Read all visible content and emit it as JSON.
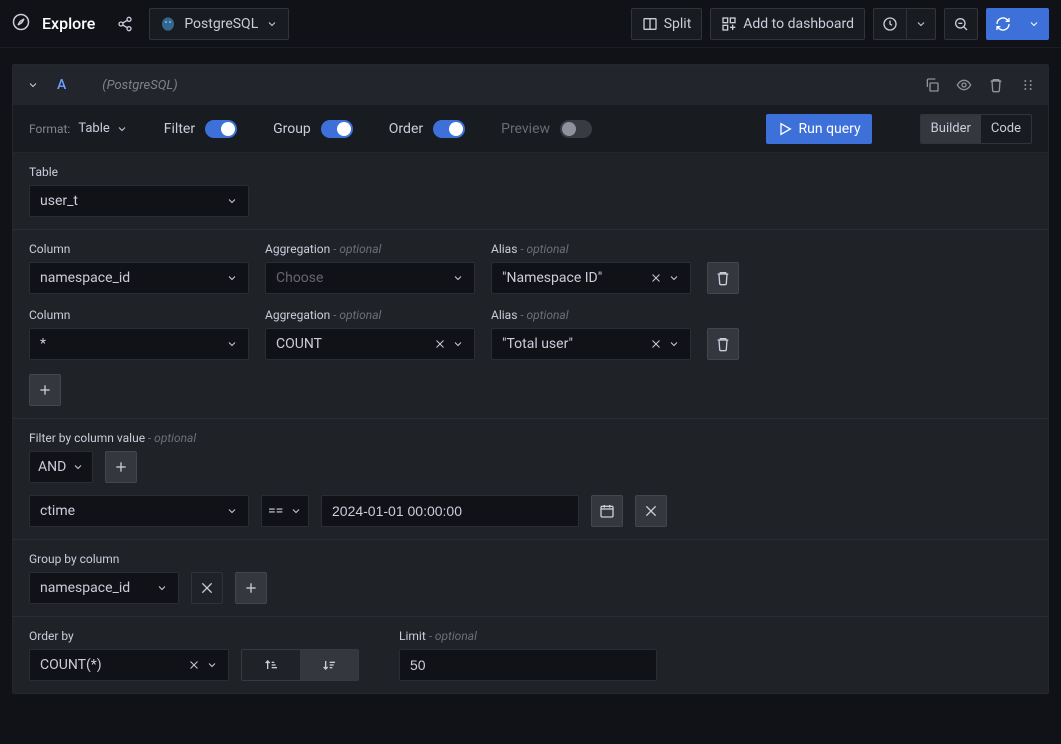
{
  "topbar": {
    "title": "Explore",
    "datasource": "PostgreSQL",
    "split_label": "Split",
    "add_dashboard_label": "Add to dashboard"
  },
  "query_header": {
    "letter": "A",
    "ds_hint": "(PostgreSQL)"
  },
  "opts": {
    "format_label": "Format:",
    "format_value": "Table",
    "filter_label": "Filter",
    "group_label": "Group",
    "order_label": "Order",
    "preview_label": "Preview",
    "run_label": "Run query",
    "builder_label": "Builder",
    "code_label": "Code"
  },
  "table_section": {
    "label": "Table",
    "value": "user_t"
  },
  "columns": [
    {
      "column_label": "Column",
      "column_value": "namespace_id",
      "agg_label": "Aggregation",
      "agg_optional": " - optional",
      "agg_value": "",
      "agg_placeholder": "Choose",
      "alias_label": "Alias",
      "alias_optional": " - optional",
      "alias_value": "\"Namespace ID\""
    },
    {
      "column_label": "Column",
      "column_value": "*",
      "agg_label": "Aggregation",
      "agg_optional": " - optional",
      "agg_value": "COUNT",
      "alias_label": "Alias",
      "alias_optional": " - optional",
      "alias_value": "\"Total user\""
    }
  ],
  "filter": {
    "label": "Filter by column value",
    "optional": " - optional",
    "logic": "AND",
    "field": "ctime",
    "op": "==",
    "value": "2024-01-01 00:00:00"
  },
  "groupby": {
    "label": "Group by column",
    "value": "namespace_id"
  },
  "orderby": {
    "label": "Order by",
    "value": "COUNT(*)",
    "limit_label": "Limit",
    "limit_optional": " - optional",
    "limit_value": "50"
  }
}
